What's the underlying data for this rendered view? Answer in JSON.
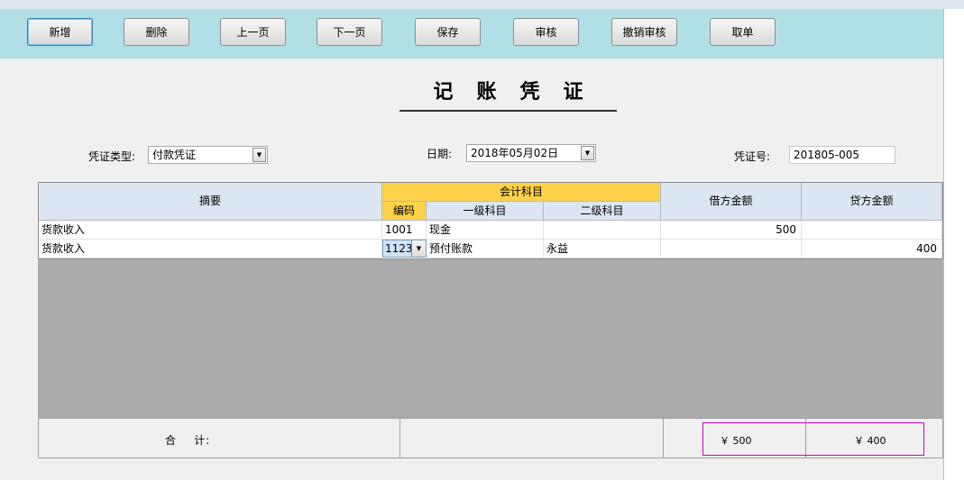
{
  "toolbar": {
    "buttons": [
      "新增",
      "删除",
      "上一页",
      "下一页",
      "保存",
      "审核",
      "撤销审核",
      "取单"
    ]
  },
  "title": "记账凭证",
  "form": {
    "type_label": "凭证类型:",
    "type_value": "付款凭证",
    "date_label": "日期:",
    "date_value": "2018年05月02日",
    "no_label": "凭证号:",
    "no_value": "201805-005"
  },
  "table": {
    "headers": {
      "summary": "摘要",
      "account_group": "会计科目",
      "code": "编码",
      "level1": "一级科目",
      "level2": "二级科目",
      "debit": "借方金额",
      "credit": "贷方金额"
    },
    "rows": [
      {
        "summary": "货款收入",
        "code": "1001",
        "level1": "现金",
        "level2": "",
        "debit": "500",
        "credit": ""
      },
      {
        "summary": "货款收入",
        "code": "1123",
        "level1": "预付账款",
        "level2": "永益",
        "debit": "",
        "credit": "400"
      }
    ]
  },
  "footer": {
    "total_label": "合    计:",
    "debit_total": "￥ 500",
    "credit_total": "￥ 400"
  },
  "colors": {
    "toolbar_bg": "#b0e0e6",
    "header_bg": "#dce6f3",
    "group_header": "#ffd24a",
    "empty_area": "#ababab",
    "total_highlight": "#d000d0"
  },
  "icons": [
    "dropdown-arrow-icon"
  ]
}
